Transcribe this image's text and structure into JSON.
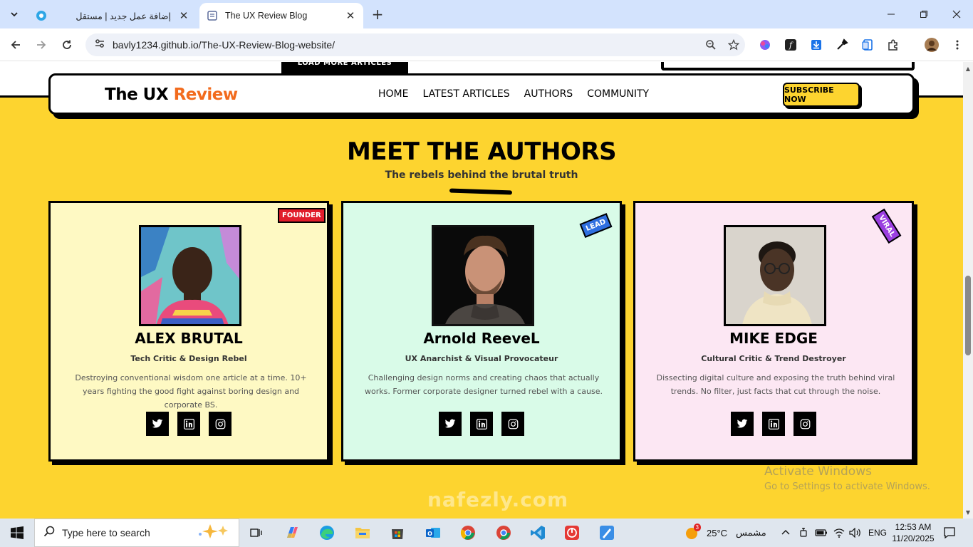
{
  "browser": {
    "tabs": [
      {
        "title": "إضافة عمل جديد | مستقل",
        "active": false
      },
      {
        "title": "The UX Review Blog",
        "active": true
      }
    ],
    "url": "bavly1234.github.io/The-UX-Review-Blog-website/"
  },
  "page": {
    "load_more_label": "LOAD MORE ARTICLES",
    "logo": {
      "part1": "The UX ",
      "part2": "Review"
    },
    "nav": [
      "HOME",
      "LATEST ARTICLES",
      "AUTHORS",
      "COMMUNITY"
    ],
    "subscribe_label": "SUBSCRIBE NOW",
    "section_title": "MEET THE AUTHORS",
    "section_subtitle": "The rebels behind the brutal truth",
    "authors": [
      {
        "badge": "FOUNDER",
        "name": "ALEX BRUTAL",
        "role": "Tech Critic & Design Rebel",
        "bio": "Destroying conventional wisdom one article at a time. 10+ years fighting the good fight against boring design and corporate BS.",
        "card_color": "#fef9c3",
        "badge_color": "#e11d2b"
      },
      {
        "badge": "LEAD",
        "name": "Arnold ReeveL",
        "role": "UX Anarchist & Visual Provocateur",
        "bio": "Challenging design norms and creating chaos that actually works. Former corporate designer turned rebel with a cause.",
        "card_color": "#d9fbe8",
        "badge_color": "#2f6fe0"
      },
      {
        "badge": "VIRAL",
        "name": "MIKE EDGE",
        "role": "Cultural Critic & Trend Destroyer",
        "bio": "Dissecting digital culture and exposing the truth behind viral trends. No filter, just facts that cut through the noise.",
        "card_color": "#fce7f3",
        "badge_color": "#9b3fe0"
      }
    ],
    "watermark": {
      "line1": "Activate Windows",
      "line2": "Go to Settings to activate Windows."
    },
    "overlay_brand": "nafezly.com"
  },
  "taskbar": {
    "search_placeholder": "Type here to search",
    "weather": {
      "temp": "25°C",
      "condition": "مشمس",
      "alert_count": "3"
    },
    "language": "ENG",
    "time": "12:53 AM",
    "date": "11/20/2025"
  },
  "colors": {
    "page_bg": "#fdd42f",
    "logo_accent": "#f26b1d"
  }
}
